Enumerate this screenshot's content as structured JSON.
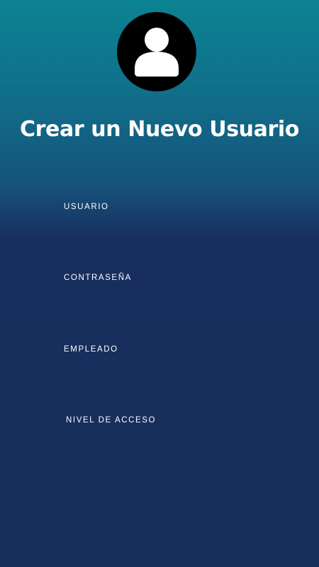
{
  "header": {
    "avatar_icon": "user-icon",
    "title": "Crear un Nuevo Usuario"
  },
  "form": {
    "fields": [
      {
        "label": "USUARIO",
        "value": ""
      },
      {
        "label": "CONTRASEÑA",
        "value": ""
      },
      {
        "label": "EMPLEADO",
        "value": ""
      },
      {
        "label": "NIVEL DE ACCESO",
        "value": ""
      }
    ]
  },
  "colors": {
    "gradient_top": "#0b8393",
    "gradient_bottom": "#182e5b",
    "text": "#ffffff",
    "avatar_bg": "#000000"
  }
}
